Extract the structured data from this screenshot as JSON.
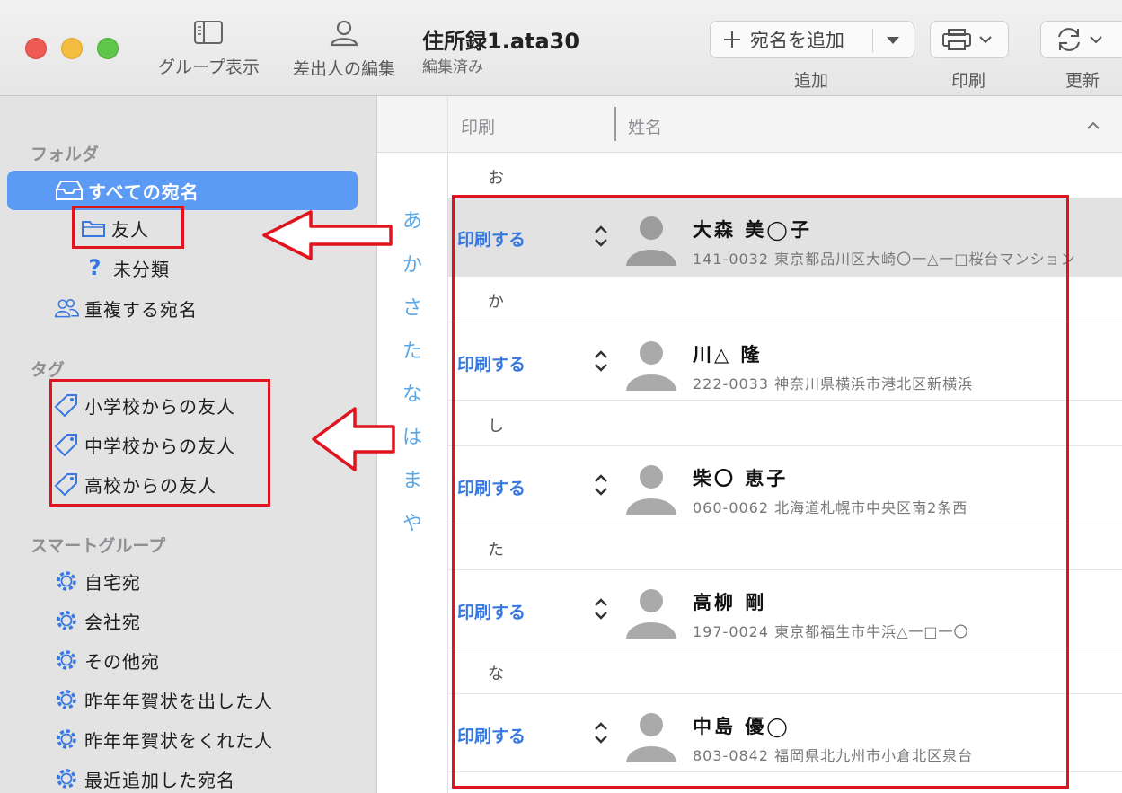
{
  "toolbar": {
    "group_view": "グループ表示",
    "edit_sender": "差出人の編集",
    "doc_title": "住所録1.ata30",
    "doc_status": "編集済み",
    "add_button": "宛名を追加",
    "add_label": "追加",
    "print_label": "印刷",
    "update_label": "更新"
  },
  "sidebar": {
    "folder_heading": "フォルダ",
    "all_addresses": "すべての宛名",
    "folders": [
      "友人",
      "未分類"
    ],
    "duplicates": "重複する宛名",
    "tag_heading": "タグ",
    "tags": [
      "小学校からの友人",
      "中学校からの友人",
      "高校からの友人"
    ],
    "smart_heading": "スマートグループ",
    "smart_groups": [
      "自宅宛",
      "会社宛",
      "その他宛",
      "昨年年賀状を出した人",
      "昨年年賀状をくれた人",
      "最近追加した宛名"
    ]
  },
  "index": [
    "あ",
    "か",
    "さ",
    "た",
    "な",
    "は",
    "ま",
    "や"
  ],
  "list": {
    "col_print": "印刷",
    "col_name": "姓名",
    "print_action": "印刷する",
    "sections": [
      {
        "heading": "お",
        "name": "大森 美◯子",
        "address": "141-0032 東京都品川区大崎〇一△一□桜台マンション"
      },
      {
        "heading": "か",
        "name": "川△ 隆",
        "address": "222-0033 神奈川県横浜市港北区新横浜"
      },
      {
        "heading": "し",
        "name": "柴〇 恵子",
        "address": "060-0062 北海道札幌市中央区南2条西"
      },
      {
        "heading": "た",
        "name": "高柳 剛",
        "address": "197-0024 東京都福生市牛浜△一□一〇"
      },
      {
        "heading": "な",
        "name": "中島 優◯",
        "address": "803-0842 福岡県北九州市小倉北区泉台"
      }
    ]
  },
  "colors": {
    "accent": "#5b9bf5",
    "link": "#3778e0",
    "annotation": "#e0141e",
    "index": "#5aa7e6"
  }
}
